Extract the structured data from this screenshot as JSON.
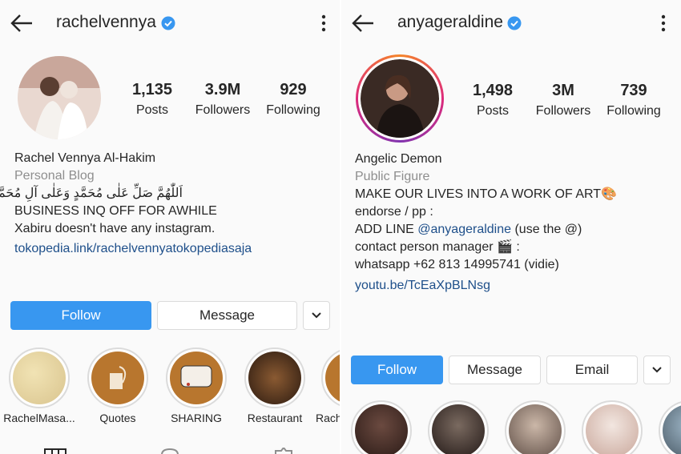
{
  "left": {
    "username": "rachelvennya",
    "stats": [
      {
        "value": "1,135",
        "label": "Posts"
      },
      {
        "value": "3.9M",
        "label": "Followers"
      },
      {
        "value": "929",
        "label": "Following"
      }
    ],
    "bio": {
      "name": "Rachel Vennya Al-Hakim",
      "category": "Personal Blog",
      "lines": [
        "اَللّٰهُمَّ صَلِّ عَلٰى مُحَمَّدٍ وَعَلٰى آلِ مُحَمَّدٍ",
        "BUSINESS INQ OFF FOR AWHILE",
        "Xabiru doesn't have any instagram."
      ],
      "link": "tokopedia.link/rachelvennyatokopediasaja"
    },
    "buttons": {
      "follow": "Follow",
      "message": "Message"
    },
    "highlights": [
      "RachelMasa...",
      "Quotes",
      "SHARING",
      "Restaurant",
      "Rach"
    ]
  },
  "right": {
    "username": "anyageraldine",
    "stats": [
      {
        "value": "1,498",
        "label": "Posts"
      },
      {
        "value": "3M",
        "label": "Followers"
      },
      {
        "value": "739",
        "label": "Following"
      }
    ],
    "bio": {
      "name": "Angelic Demon",
      "category": "Public Figure",
      "line1": "MAKE OUR LIVES INTO A WORK OF ART🎨",
      "line2": "endorse / pp :",
      "line3_pre": "ADD LINE ",
      "line3_mention": "@anyageraldine",
      "line3_post": " (use the @)",
      "line4": "contact person manager 🎬 :",
      "line5": "whatsapp +62 813 14995741 (vidie)",
      "link": "youtu.be/TcEaXpBLNsg"
    },
    "buttons": {
      "follow": "Follow",
      "message": "Message",
      "email": "Email"
    }
  },
  "colors": {
    "primary": "#3897f0",
    "link": "#1e4f8a",
    "verified": "#3897f0",
    "muted": "#8e8e8e",
    "story_ring": "#d6249f"
  }
}
